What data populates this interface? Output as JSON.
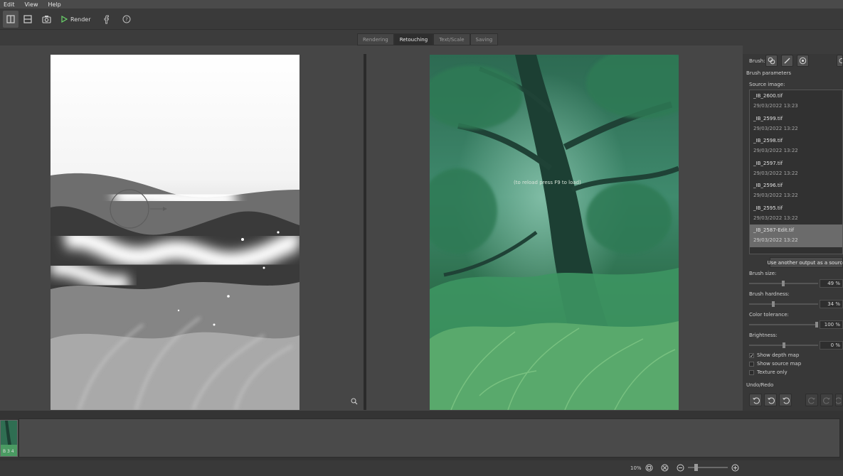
{
  "menu": [
    "Edit",
    "View",
    "Help"
  ],
  "toolbar": {
    "render_label": "Render",
    "icons": [
      "split-view-vertical-icon",
      "split-view-horizontal-icon",
      "snapshot-icon",
      "play-icon",
      "facebook-icon",
      "help-icon"
    ]
  },
  "tabs": [
    {
      "label": "Rendering",
      "active": false
    },
    {
      "label": "Retouching",
      "active": true
    },
    {
      "label": "Text/Scale",
      "active": false
    },
    {
      "label": "Saving",
      "active": false
    }
  ],
  "preview": {
    "hint": "(to reload press F9 to load)"
  },
  "panel": {
    "brush_label": "Brush:",
    "brush_params_title": "Brush parameters",
    "source_image_label": "Source image:",
    "files": [
      {
        "name": "_IB_2600.tif",
        "date": "29/03/2022 13:23",
        "selected": false
      },
      {
        "name": "_IB_2599.tif",
        "date": "29/03/2022 13:22",
        "selected": false
      },
      {
        "name": "_IB_2598.tif",
        "date": "29/03/2022 13:22",
        "selected": false
      },
      {
        "name": "_IB_2597.tif",
        "date": "29/03/2022 13:22",
        "selected": false
      },
      {
        "name": "_IB_2596.tif",
        "date": "29/03/2022 13:22",
        "selected": false
      },
      {
        "name": "_IB_2595.tif",
        "date": "29/03/2022 13:22",
        "selected": false
      },
      {
        "name": "_IB_2587-Edit.tif",
        "date": "29/03/2022 13:22",
        "selected": true
      }
    ],
    "use_source_button": "Use another output as a source",
    "brush_size": {
      "label": "Brush size:",
      "value": "49 %",
      "level": 0.49
    },
    "brush_hardness": {
      "label": "Brush hardness:",
      "value": "34 %",
      "level": 0.34
    },
    "color_tolerance": {
      "label": "Color tolerance:",
      "value": "100 %",
      "level": 1.0
    },
    "brightness": {
      "label": "Brightness:",
      "value": "0 %",
      "level": 0.5
    },
    "show_depth_map": {
      "label": "Show depth map",
      "checked": true
    },
    "show_source_map": {
      "label": "Show source map",
      "checked": false
    },
    "texture_only": {
      "label": "Texture only",
      "checked": false
    },
    "undo_redo_title": "Undo/Redo"
  },
  "filmstrip": {
    "thumb_label": "B 3 4"
  },
  "status": {
    "zoom": "10%"
  },
  "colors": {
    "foliage_dark": "#1f4a36",
    "foliage_mid": "#2f7a55",
    "foliage_light": "#5fae6e",
    "panel_bg": "#383838"
  }
}
